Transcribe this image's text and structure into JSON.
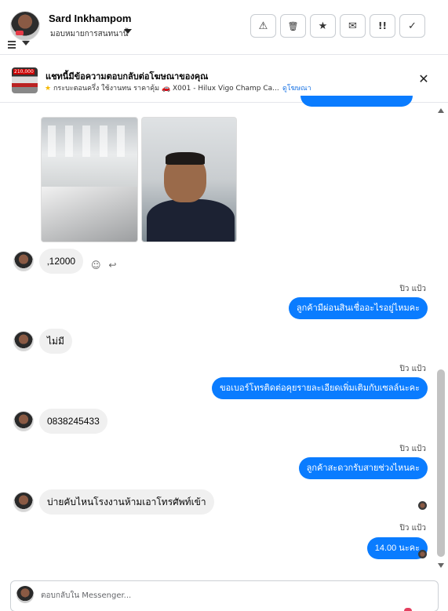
{
  "header": {
    "contact_name": "Sard Inkhampom",
    "assign_label": "มอบหมายการสนทนานี้",
    "actions": [
      {
        "name": "report-button",
        "glyph": "⚠"
      },
      {
        "name": "delete-button",
        "glyph": "🗑"
      },
      {
        "name": "star-button",
        "glyph": "★"
      },
      {
        "name": "mark-unread-button",
        "glyph": "✉"
      },
      {
        "name": "mark-spam-button",
        "glyph": "!!"
      },
      {
        "name": "mark-done-button",
        "glyph": "✓"
      }
    ]
  },
  "ad": {
    "title": "แชทนี้มีข้อความตอบกลับต่อโฆษณาของคุณ",
    "subtitle": "กระบะตอนครึ่ง ใช้งานทน ราคาคุ้ม 🚗 X001 - Hilux Vigo Champ Ca...",
    "link": "ดูโฆษณา",
    "thumb_price": "210,000",
    "close_glyph": "✕"
  },
  "messages": {
    "m1": "‚12000",
    "s1": "ปิว แป้ว",
    "o1": "ลูกค้ามีผ่อนสินเชื่ออะไรอยู่ไหมคะ",
    "m2": "ไม่มี",
    "s2": "ปิว แป้ว",
    "o2": "ขอเบอร์โทรติดต่อคุยรายละเอียดเพิ่มเติมกับเซลล์นะคะ",
    "m3": "0838245433",
    "s3": "ปิว แป้ว",
    "o3": "ลูกค้าสะดวกรับสายช่วงไหนคะ",
    "m4": "บ่ายคับไหนโรงงานห้ามเอาโทรศัพท์เข้า",
    "s4": "ปิว แป้ว",
    "o4": "14.00  นะคะ"
  },
  "reactions": {
    "emoji": "☺",
    "reply": "↩"
  },
  "composer": {
    "placeholder": "ตอบกลับใน Messenger..."
  }
}
